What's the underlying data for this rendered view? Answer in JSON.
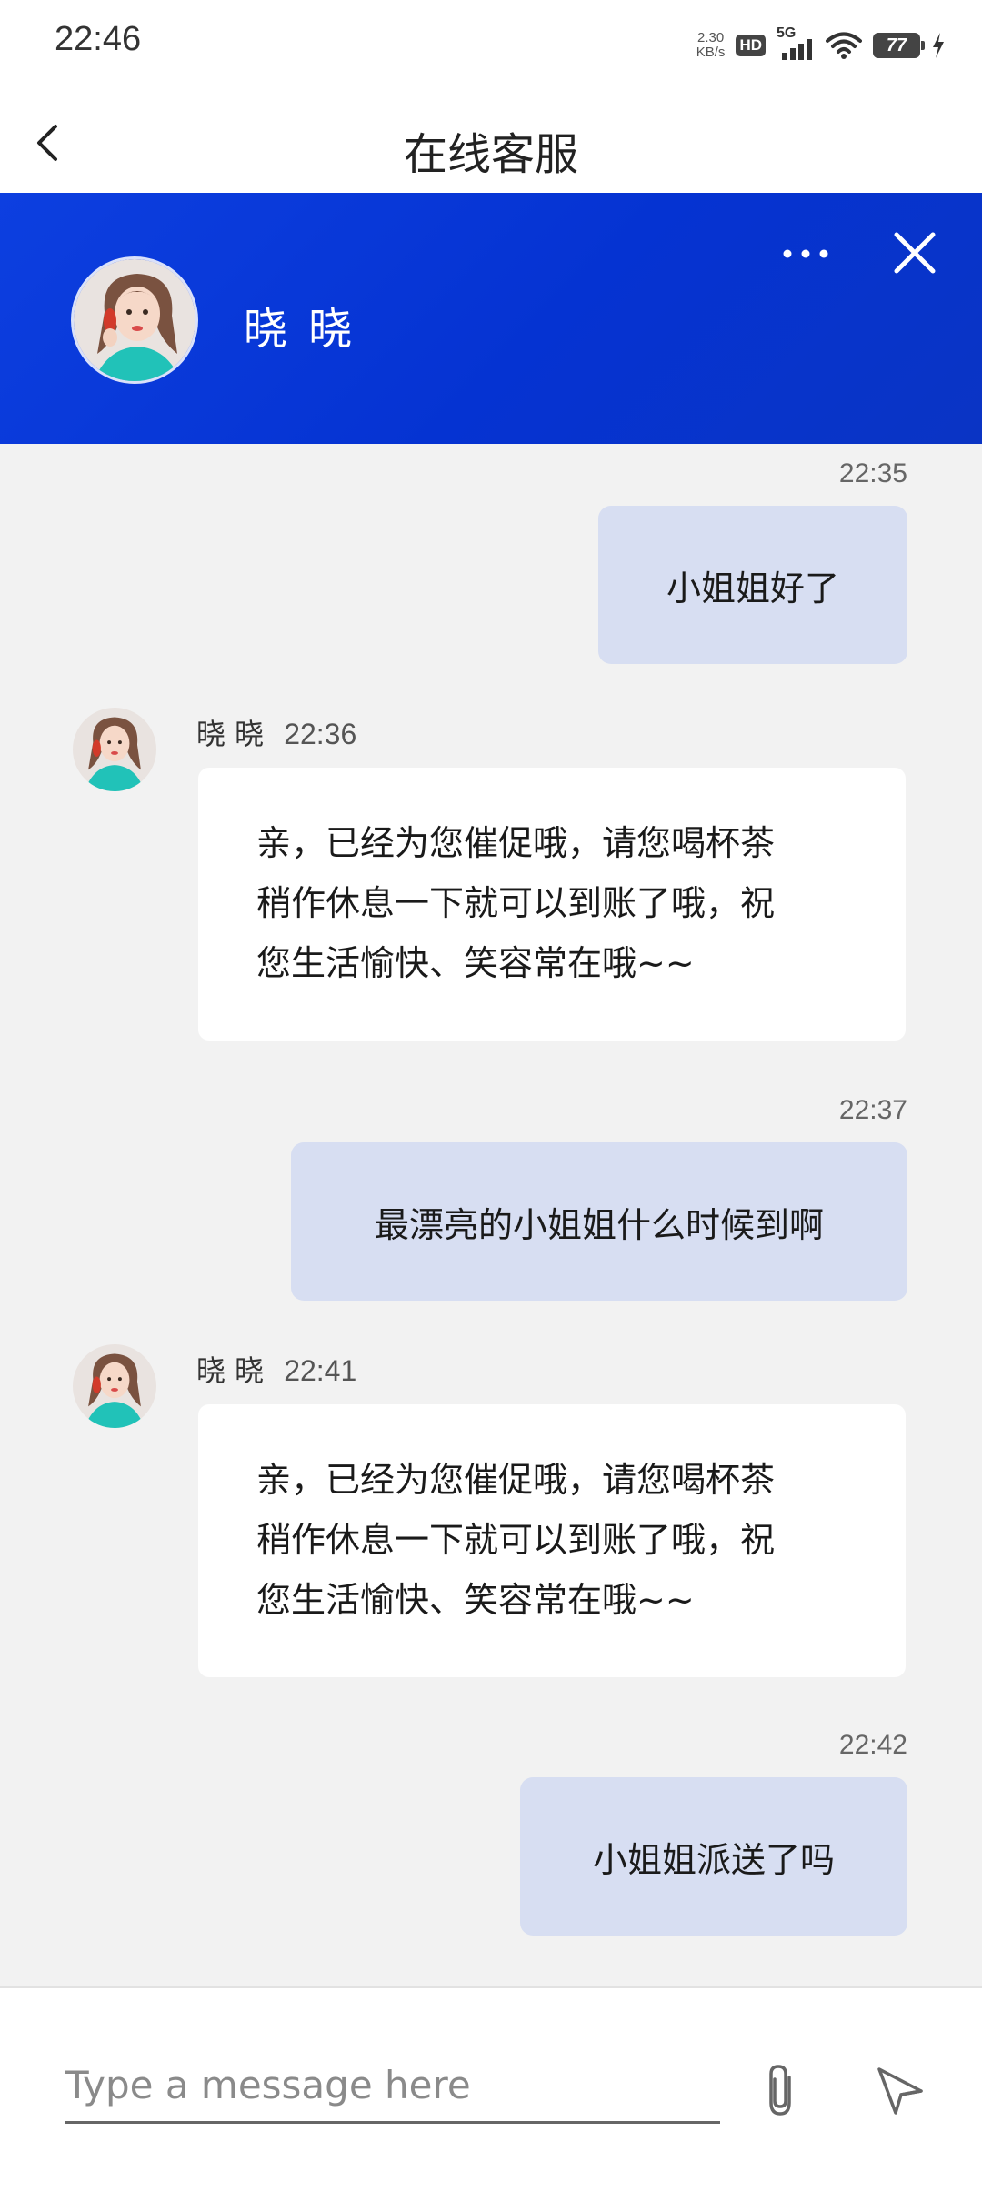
{
  "status_bar": {
    "time": "22:46",
    "net_speed_value": "2.30",
    "net_speed_unit": "KB/s",
    "hd_label": "HD",
    "network_type": "5G",
    "battery_level": "77"
  },
  "nav": {
    "title": "在线客服"
  },
  "agent": {
    "name": "晓 晓"
  },
  "messages": [
    {
      "direction": "out",
      "time": "22:35",
      "text": "小姐姐好了"
    },
    {
      "direction": "in",
      "sender": "晓 晓",
      "time": "22:36",
      "lines": [
        "亲，已经为您催促哦，请您喝杯茶",
        "稍作休息一下就可以到账了哦，祝",
        "您生活愉快、笑容常在哦~~"
      ]
    },
    {
      "direction": "out",
      "time": "22:37",
      "text": "最漂亮的小姐姐什么时候到啊"
    },
    {
      "direction": "in",
      "sender": "晓 晓",
      "time": "22:41",
      "lines": [
        "亲，已经为您催促哦，请您喝杯茶",
        "稍作休息一下就可以到账了哦，祝",
        "您生活愉快、笑容常在哦~~"
      ]
    },
    {
      "direction": "out",
      "time": "22:42",
      "text": "小姐姐派送了吗"
    }
  ],
  "composer": {
    "placeholder": "Type a message here",
    "value": ""
  },
  "icons": {
    "back": "chevron-left-icon",
    "more": "more-dots-icon",
    "close": "close-icon",
    "attach": "paperclip-icon",
    "send": "send-icon"
  },
  "colors": {
    "header_blue": "#0533d2",
    "outgoing_bubble": "#d7def2",
    "incoming_bubble": "#ffffff",
    "chat_background": "#f2f2f2"
  }
}
